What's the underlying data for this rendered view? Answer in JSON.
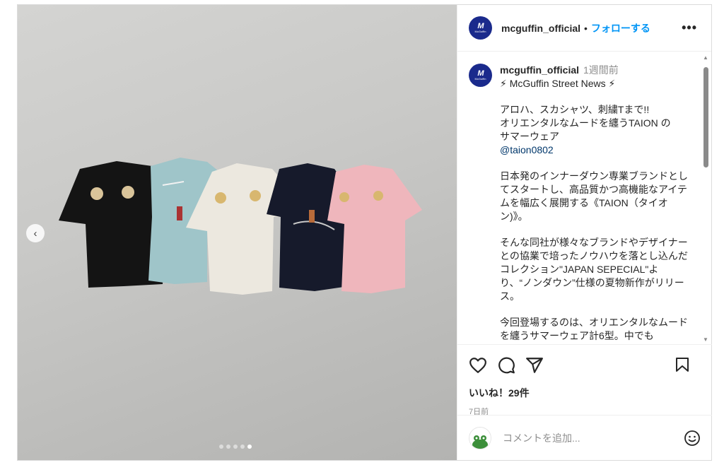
{
  "post": {
    "username": "mcguffin_official",
    "follow_label": "フォローする",
    "separator": "•",
    "more_label": "•••",
    "avatar_mark": "M",
    "avatar_sub": "McGuffin"
  },
  "caption": {
    "username": "mcguffin_official",
    "time": "1週間前",
    "headline": "⚡ McGuffin Street News ⚡",
    "lines_1": [
      "アロハ、スカシャツ、刺繍Tまで!!",
      "オリエンタルなムードを纏うTAION の",
      "サマーウェア"
    ],
    "mention": "@taion0802",
    "para_2": "日本発のインナーダウン専業ブランドとしてスタートし、高品質かつ高機能なアイテムを幅広く展開する《TAION（タイオン)》。",
    "para_3": "そんな同社が様々なブランドやデザイナーとの協業で培ったノウハウを落とし込んだコレクション\"JAPAN SEPECIAL\"より、“ノンダウン”仕様の夏物新作がリリース。",
    "para_4": "今回登場するのは、オリエンタルなムードを纏うサマーウェア計6型。中でも"
  },
  "media": {
    "prev_icon": "‹",
    "dots_total": 5,
    "dots_active": 5
  },
  "actions": {
    "icons": [
      "heart-icon",
      "comment-icon",
      "share-icon",
      "bookmark-icon"
    ],
    "likes": "いいね！29件",
    "posted": "7日前"
  },
  "comment": {
    "placeholder": "コメントを追加...",
    "emoji_icon": "smiley-icon"
  },
  "colors": {
    "accent": "#0095f6",
    "brand_avatar": "#1a2a8c",
    "link": "#00376b"
  }
}
